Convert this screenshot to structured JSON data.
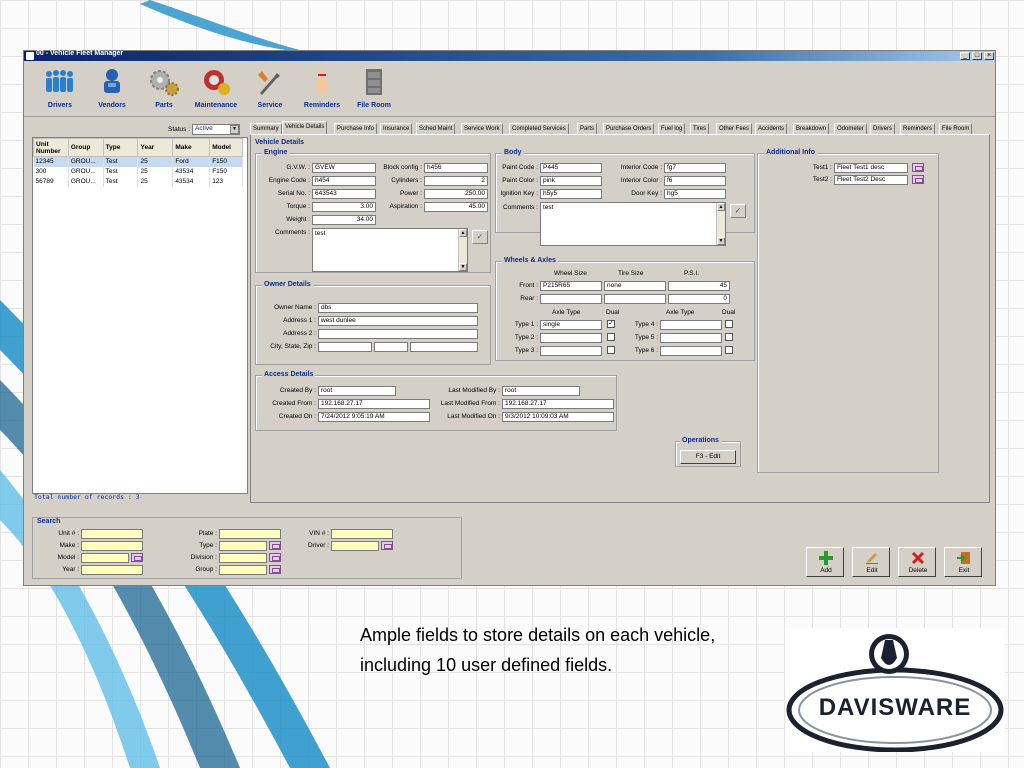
{
  "window": {
    "title": "00 - Vehicle Fleet Manager"
  },
  "toolbar": [
    {
      "label": "Drivers",
      "icon": "people-icon"
    },
    {
      "label": "Vendors",
      "icon": "vendor-icon"
    },
    {
      "label": "Parts",
      "icon": "gears-icon"
    },
    {
      "label": "Maintenance",
      "icon": "maintenance-icon"
    },
    {
      "label": "Service",
      "icon": "wrench-icon"
    },
    {
      "label": "Reminders",
      "icon": "reminder-finger-icon"
    },
    {
      "label": "File Room",
      "icon": "filing-cabinet-icon"
    }
  ],
  "list": {
    "status_label": "Status :",
    "status_value": "Active",
    "columns": [
      "Unit Number",
      "Group",
      "Type",
      "Year",
      "Make",
      "Model"
    ],
    "rows": [
      [
        "12345",
        "GROU...",
        "Test",
        "25",
        "Ford",
        "F150"
      ],
      [
        "300",
        "GROU...",
        "Test",
        "25",
        "43534",
        "F150"
      ],
      [
        "56789",
        "GROU...",
        "Test",
        "25",
        "43534",
        "123"
      ]
    ],
    "footer": "Total number of records : 3"
  },
  "tabs": [
    "Summary",
    "Vehicle Details",
    "Purchase Info",
    "Insurance",
    "Sched Maint",
    "Service Work",
    "Completed Services",
    "Parts",
    "Purchase Orders",
    "Fuel log",
    "Tires",
    "Other Fees",
    "Accidents",
    "Breakdown",
    "Odometer",
    "Drivers",
    "Reminders",
    "File Room"
  ],
  "details": {
    "section_title": "Vehicle Details",
    "engine": {
      "title": "Engine",
      "gvw_label": "G.V.W. :",
      "gvw": "GVEW",
      "engine_code_label": "Engine Code :",
      "engine_code": "h454",
      "serial_label": "Serial No. :",
      "serial": "643543",
      "torque_label": "Torque :",
      "torque": "3.00",
      "weight_label": "Weight :",
      "weight": "34.00",
      "block_label": "Block config :",
      "block": "h456",
      "cyl_label": "Cylinders :",
      "cyl": "2",
      "power_label": "Power :",
      "power": "250.00",
      "asp_label": "Aspiration :",
      "asp": "45.00",
      "comments_label": "Comments :",
      "comments": "test"
    },
    "body": {
      "title": "Body",
      "paint_code_label": "Paint Code :",
      "paint_code": "P445",
      "paint_color_label": "Paint Color :",
      "paint_color": "pink",
      "ign_label": "Ignition Key :",
      "ign": "h5y5",
      "int_code_label": "Interior Code :",
      "int_code": "fg7",
      "int_color_label": "Interior Color :",
      "int_color": "f6",
      "door_label": "Door Key :",
      "door": "hg5",
      "comments_label": "Comments :",
      "comments": "test"
    },
    "additional": {
      "title": "Additional Info",
      "test1_label": "Test1 :",
      "test1": "Fleet Test1 desc",
      "test2_label": "Test2 :",
      "test2": "Fleet Test2 Desc"
    },
    "owner": {
      "title": "Owner Details",
      "name_label": "Owner Name :",
      "name": "dbs",
      "addr1_label": "Address 1 :",
      "addr1": "west dunlee",
      "addr2_label": "Address 2 :",
      "addr2": "",
      "csz_label": "City, State, Zip :"
    },
    "wheels": {
      "title": "Wheels & Axles",
      "col_wheel": "Wheel Size",
      "col_tire": "Tire Size",
      "col_psi": "P.S.I.",
      "front_label": "Front :",
      "front_wheel": "P215R65",
      "front_tire": "none",
      "front_psi": "45",
      "rear_label": "Rear :",
      "rear_wheel": "",
      "rear_tire": "",
      "rear_psi": "0",
      "axle_type": "Axle Type",
      "dual": "Dual",
      "type1_label": "Type 1 :",
      "type1": "single",
      "type2_label": "Type 2 :",
      "type3_label": "Type 3 :",
      "type4_label": "Type 4 :",
      "type5_label": "Type 5 :",
      "type6_label": "Type 6 :"
    },
    "access": {
      "title": "Access Details",
      "created_by_label": "Created By :",
      "created_by": "root",
      "created_from_label": "Created From :",
      "created_from": "192.168.27.17",
      "created_on_label": "Created On :",
      "created_on": "7/24/2012 9:05:19 AM",
      "mod_by_label": "Last Modified By :",
      "mod_by": "root",
      "mod_from_label": "Last Modified From :",
      "mod_from": "192.168.27.17",
      "mod_on_label": "Last Modified On :",
      "mod_on": "9/3/2012 10:09:03 AM"
    },
    "operations": {
      "title": "Operations",
      "edit": "F3 - Edit"
    }
  },
  "search": {
    "title": "Search",
    "unit_label": "Unit # :",
    "make_label": "Make :",
    "model_label": "Model :",
    "year_label": "Year :",
    "plate_label": "Plate :",
    "type_label": "Type :",
    "division_label": "Division :",
    "group_label": "Group :",
    "vin_label": "VIN # :",
    "driver_label": "Driver :"
  },
  "actions": {
    "add": "Add",
    "edit": "Edit",
    "delete": "Delete",
    "exit": "Exit"
  },
  "caption": "Ample fields to store details on each vehicle, including 10 user defined fields.",
  "logo": {
    "text": "DAVISWARE"
  }
}
